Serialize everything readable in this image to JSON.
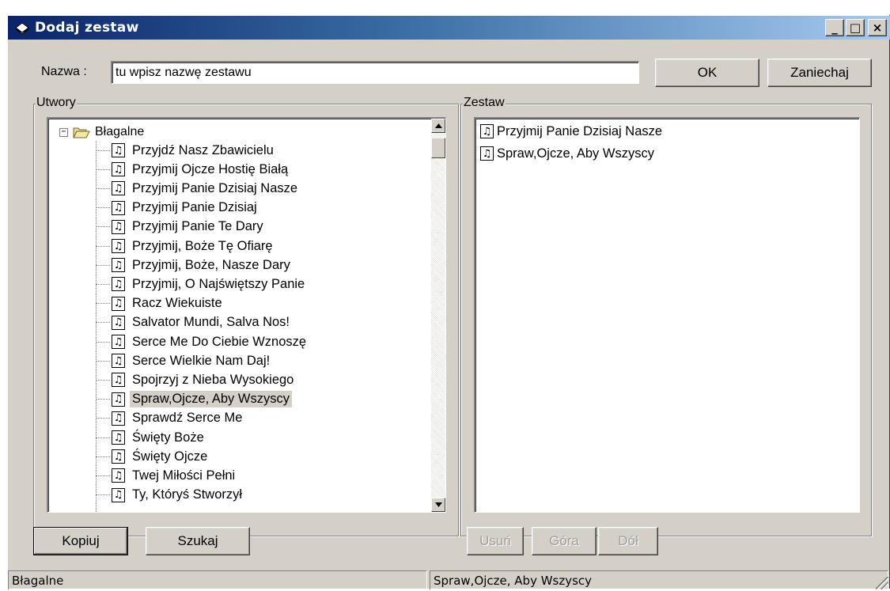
{
  "window": {
    "title": "Dodaj zestaw"
  },
  "title_buttons": {
    "minimize": "_",
    "maximize": "□",
    "close": "×"
  },
  "name_row": {
    "label": "Nazwa :",
    "value": "tu wpisz nazwę zestawu",
    "ok_label": "OK",
    "cancel_label": "Zaniechaj"
  },
  "songs_group": {
    "title": "Utwory",
    "category": "Błagalne",
    "items": [
      "Przyjdź Nasz Zbawicielu",
      "Przyjmij Ojcze Hostię Białą",
      "Przyjmij Panie Dzisiaj Nasze",
      "Przyjmij Panie Dzisiaj",
      "Przyjmij Panie Te Dary",
      "Przyjmij, Boże Tę Ofiarę",
      "Przyjmij, Boże, Nasze Dary",
      "Przyjmij, O Najświętszy Panie",
      "Racz Wiekuiste",
      "Salvator Mundi, Salva Nos!",
      "Serce Me Do Ciebie Wznoszę",
      "Serce Wielkie Nam Daj!",
      "Spojrzyj z Nieba Wysokiego",
      "Spraw,Ojcze, Aby Wszyscy",
      "Sprawdź Serce Me",
      "Święty Boże",
      "Święty Ojcze",
      "Twej Miłości Pełni",
      "Ty, Któryś Stworzył"
    ],
    "selected_index": 13
  },
  "set_group": {
    "title": "Zestaw",
    "items": [
      "Przyjmij Panie Dzisiaj Nasze",
      "Spraw,Ojcze, Aby Wszyscy"
    ]
  },
  "buttons": {
    "copy": "Kopiuj",
    "search": "Szukaj",
    "remove": "Usuń",
    "up": "Góra",
    "down": "Dół"
  },
  "status": {
    "left": "Błagalne",
    "right": "Spraw,Ojcze, Aby Wszyscy"
  },
  "icons": {
    "window": "book-icon",
    "folder": "open-folder-icon",
    "song": "music-note-icon",
    "scroll_up": "arrow-up-icon",
    "scroll_down": "arrow-down-icon"
  }
}
